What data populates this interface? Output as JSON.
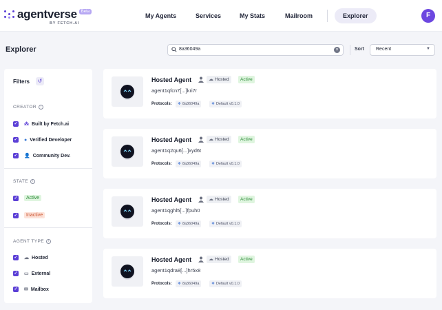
{
  "brand": {
    "name": "agentverse",
    "badge": "Beta",
    "byline": "BY FETCH.AI"
  },
  "nav": {
    "items": [
      "My Agents",
      "Services",
      "My Stats",
      "Mailroom",
      "Explorer"
    ],
    "active": "Explorer",
    "avatar_initial": "F"
  },
  "page": {
    "title": "Explorer"
  },
  "search": {
    "value": "8a36049a"
  },
  "sort": {
    "label": "Sort",
    "value": "Recent"
  },
  "filters": {
    "title": "Filters",
    "creator": {
      "heading": "CREATOR",
      "options": [
        "Built by Fetch.ai",
        "Verified Developer",
        "Community Dev."
      ]
    },
    "state": {
      "heading": "STATE",
      "options": [
        "Active",
        "Inactive"
      ]
    },
    "agent_type": {
      "heading": "AGENT TYPE",
      "options": [
        "Hosted",
        "External",
        "Mailbox"
      ]
    }
  },
  "agents": [
    {
      "name": "Hosted Agent",
      "type": "Hosted",
      "status": "Active",
      "address": "agent1qfcn7[...]kri7r",
      "protocols_label": "Protocols:",
      "protocols": [
        "8a36049a",
        "Default v0.1.0"
      ]
    },
    {
      "name": "Hosted Agent",
      "type": "Hosted",
      "status": "Active",
      "address": "agent1q2qu6[...]xyd6t",
      "protocols_label": "Protocols:",
      "protocols": [
        "8a36049a",
        "Default v0.1.0"
      ]
    },
    {
      "name": "Hosted Agent",
      "type": "Hosted",
      "status": "Active",
      "address": "agent1qghl5[...]fpuh0",
      "protocols_label": "Protocols:",
      "protocols": [
        "8a36049a",
        "Default v0.1.0"
      ]
    },
    {
      "name": "Hosted Agent",
      "type": "Hosted",
      "status": "Active",
      "address": "agent1qdra8[...]hr5x8",
      "protocols_label": "Protocols:",
      "protocols": [
        "8a36049a",
        "Default v0.1.0"
      ]
    }
  ],
  "colors": {
    "accent": "#5b3fd6",
    "active_bg": "#dff5df",
    "active_fg": "#2e8b3a",
    "inactive_bg": "#fde3da",
    "inactive_fg": "#c9502b"
  }
}
